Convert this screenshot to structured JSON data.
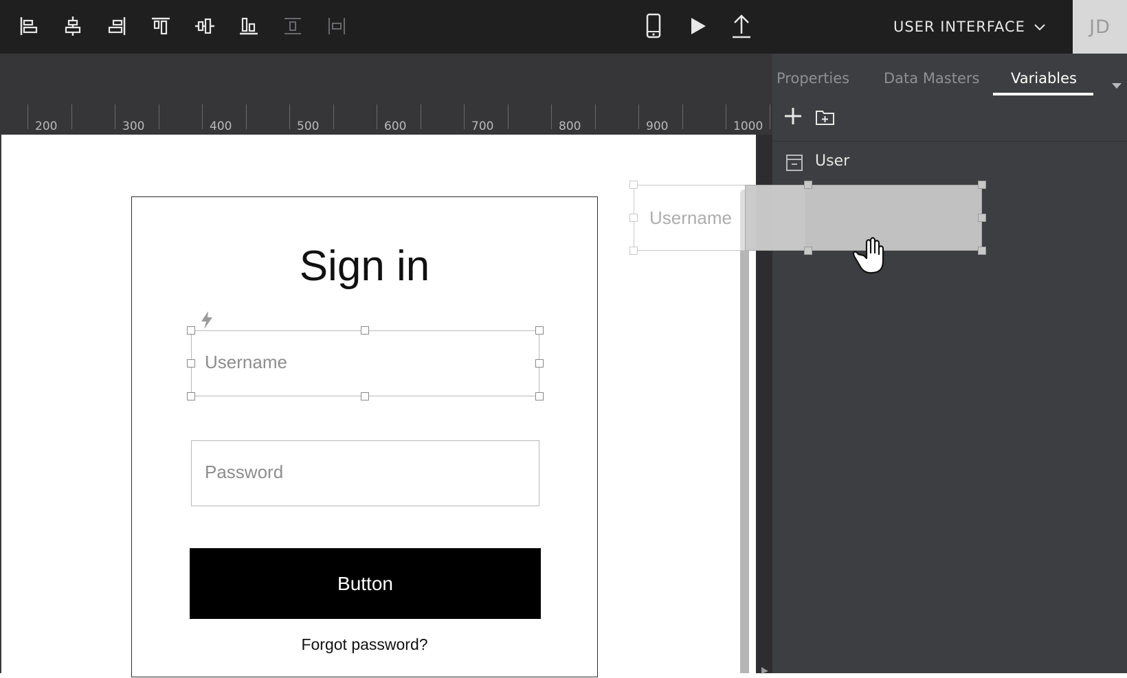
{
  "toolbar": {
    "tools": [
      {
        "name": "align-left-icon",
        "enabled": true
      },
      {
        "name": "align-center-horizontal-icon",
        "enabled": true
      },
      {
        "name": "align-right-icon",
        "enabled": true
      },
      {
        "name": "align-top-icon",
        "enabled": true
      },
      {
        "name": "align-middle-vertical-icon",
        "enabled": true
      },
      {
        "name": "align-bottom-icon",
        "enabled": true
      },
      {
        "name": "distribute-vertical-icon",
        "enabled": false
      },
      {
        "name": "distribute-horizontal-icon",
        "enabled": false
      }
    ],
    "device_icon": "phone-icon",
    "play_icon": "play-icon",
    "export_icon": "upload-icon",
    "mode_select": "USER INTERFACE",
    "avatar_initials": "JD"
  },
  "ruler": {
    "labels": [
      "200",
      "300",
      "400",
      "500",
      "600",
      "700",
      "800",
      "900",
      "1000"
    ]
  },
  "canvas": {
    "screen_title": "Sign in",
    "username_placeholder": "Username",
    "password_placeholder": "Password",
    "button_label": "Button",
    "forgot_link": "Forgot password?",
    "event_icon": "lightning-icon"
  },
  "drag_ghost": {
    "label": "Username",
    "cursor_icon": "hand-grab-icon"
  },
  "panel": {
    "tabs": [
      {
        "label": "Properties",
        "active": false
      },
      {
        "label": "Data Masters",
        "active": false
      },
      {
        "label": "Variables",
        "active": true
      }
    ],
    "add_icon": "plus-icon",
    "add_folder_icon": "folder-plus-icon",
    "items": [
      {
        "label": "User",
        "icon": "data-master-icon"
      }
    ]
  },
  "colors": {
    "toolbar_bg": "#1f1f20",
    "ruler_bg": "#363638",
    "panel_bg": "#3d3e41",
    "button_bg": "#000000",
    "ghost_fill": "#c8c8c8"
  }
}
